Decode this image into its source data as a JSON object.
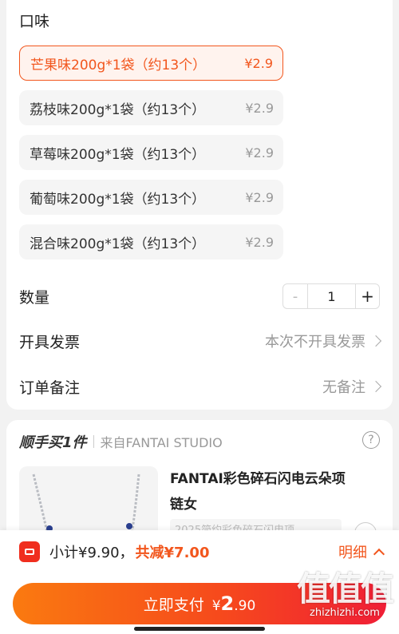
{
  "flavor": {
    "label": "口味",
    "options": [
      {
        "name": "芒果味200g*1袋（约13个）",
        "price": "¥2.9",
        "selected": true
      },
      {
        "name": "荔枝味200g*1袋（约13个）",
        "price": "¥2.9",
        "selected": false
      },
      {
        "name": "草莓味200g*1袋（约13个）",
        "price": "¥2.9",
        "selected": false
      },
      {
        "name": "葡萄味200g*1袋（约13个）",
        "price": "¥2.9",
        "selected": false
      },
      {
        "name": "混合味200g*1袋（约13个）",
        "price": "¥2.9",
        "selected": false
      }
    ]
  },
  "quantity": {
    "label": "数量",
    "minus": "-",
    "value": "1",
    "plus": "+"
  },
  "invoice": {
    "label": "开具发票",
    "value": "本次不开具发票"
  },
  "note": {
    "label": "订单备注",
    "value": "无备注"
  },
  "addon": {
    "title": "顺手买1件",
    "source": "来自FANTAI STUDIO",
    "help": "?",
    "product_title": "FANTAI彩色碎石闪电云朵项链女",
    "product_subtitle": "2025简约彩色碎石闪电项"
  },
  "bottom_bar": {
    "subtotal": "小计¥9.90，",
    "discount": "共减¥7.00",
    "detail": "明细",
    "pay_label": "立即支付",
    "pay_currency": "¥",
    "pay_integer": "2",
    "pay_decimal": ".90"
  },
  "watermark": {
    "logo": "值值值",
    "url": "zhizhizhi.com"
  },
  "colors": {
    "accent": "#f2561d",
    "pay_gradient_start": "#fa7a10",
    "pay_gradient_end": "#f01e36"
  }
}
